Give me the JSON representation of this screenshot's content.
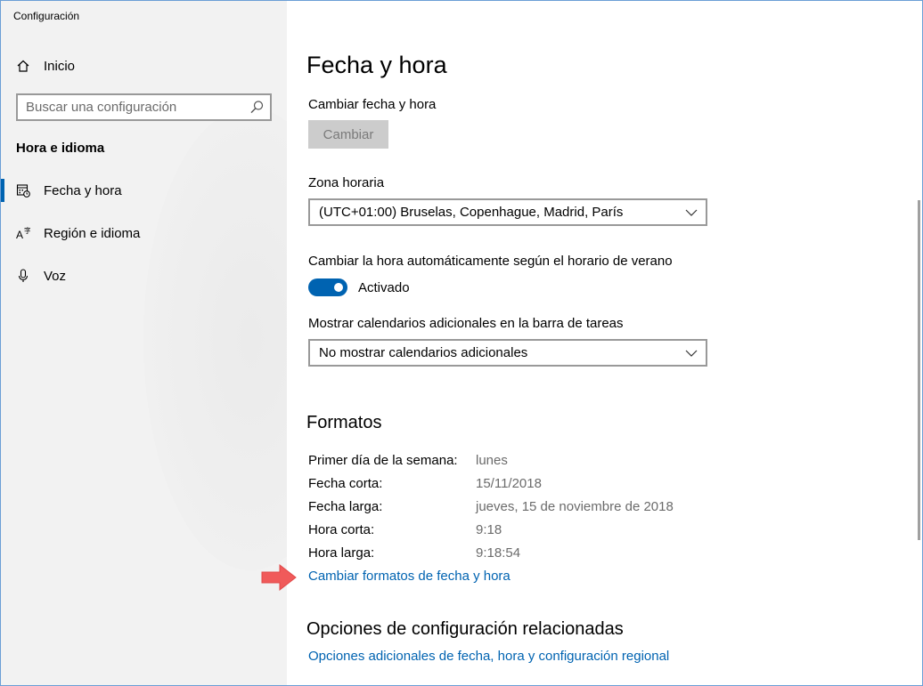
{
  "window": {
    "title": "Configuración",
    "controls": {
      "minimize": "minimize-icon",
      "maximize": "maximize-icon",
      "close": "close-icon"
    }
  },
  "sidebar": {
    "home_label": "Inicio",
    "search_placeholder": "Buscar una configuración",
    "section_title": "Hora e idioma",
    "items": [
      {
        "label": "Fecha y hora",
        "icon": "calendar-clock-icon",
        "active": true
      },
      {
        "label": "Región e idioma",
        "icon": "language-icon",
        "active": false
      },
      {
        "label": "Voz",
        "icon": "microphone-icon",
        "active": false
      }
    ]
  },
  "main": {
    "page_title": "Fecha y hora",
    "change_date_label": "Cambiar fecha y hora",
    "change_button": "Cambiar",
    "timezone_label": "Zona horaria",
    "timezone_value": "(UTC+01:00) Bruselas, Copenhague, Madrid, París",
    "dst_label": "Cambiar la hora automáticamente según el horario de verano",
    "dst_toggle_state": "Activado",
    "dst_toggle_on": true,
    "calendars_label": "Mostrar calendarios adicionales en la barra de tareas",
    "calendars_value": "No mostrar calendarios adicionales",
    "formats_title": "Formatos",
    "formats": [
      {
        "key": "Primer día de la semana:",
        "value": "lunes"
      },
      {
        "key": "Fecha corta:",
        "value": "15/11/2018"
      },
      {
        "key": "Fecha larga:",
        "value": "jueves, 15 de noviembre de 2018"
      },
      {
        "key": "Hora corta:",
        "value": "9:18"
      },
      {
        "key": "Hora larga:",
        "value": "9:18:54"
      }
    ],
    "change_formats_link": "Cambiar formatos de fecha y hora",
    "related_title": "Opciones de configuración relacionadas",
    "related_link": "Opciones adicionales de fecha, hora y configuración regional"
  },
  "colors": {
    "accent": "#0063b1",
    "sidebar_bg": "#f2f2f2",
    "annotation_arrow": "#f05a5a"
  }
}
